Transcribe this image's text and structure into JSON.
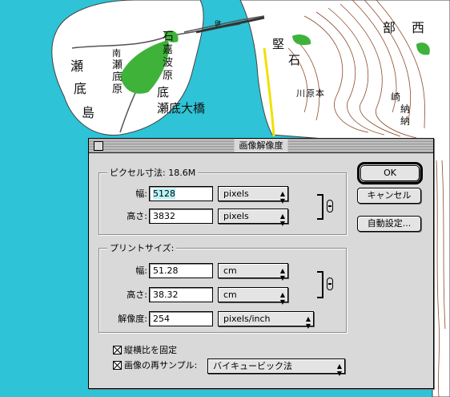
{
  "map": {
    "labels": [
      "瀬",
      "底",
      "島",
      "南",
      "瀬",
      "底",
      "原",
      "石",
      "嘉",
      "波",
      "原",
      "瀬",
      "底",
      "瀬底大橋",
      "健",
      "堅",
      "石",
      "川",
      "原",
      "本",
      "部",
      "西",
      "崎",
      "納"
    ],
    "colors": {
      "sea": "#2ec3d6",
      "land": "#ffffff",
      "vegetation": "#3fb23a",
      "contour": "#8b4a2a",
      "road": "#555555",
      "highlight_road": "#f2e000"
    }
  },
  "dialog": {
    "title": "画像解像度",
    "pixel_dimensions": {
      "label": "ピクセル寸法:  18.6M",
      "width_label": "幅:",
      "width_value": "5128",
      "width_unit": "pixels",
      "height_label": "高さ:",
      "height_value": "3832",
      "height_unit": "pixels"
    },
    "print_size": {
      "label": "プリントサイズ:",
      "width_label": "幅:",
      "width_value": "51.28",
      "width_unit": "cm",
      "height_label": "高さ:",
      "height_value": "38.32",
      "height_unit": "cm",
      "resolution_label": "解像度:",
      "resolution_value": "254",
      "resolution_unit": "pixels/inch"
    },
    "constrain_proportions": {
      "label": "縦横比を固定",
      "checked": true
    },
    "resample": {
      "label": "画像の再サンプル:",
      "checked": true,
      "method": "バイキュービック法"
    },
    "buttons": {
      "ok": "OK",
      "cancel": "キャンセル",
      "auto": "自動設定..."
    },
    "icons": {
      "popup_arrow": "up-down-arrow-icon",
      "link": "chain-link-icon",
      "close": "close-box-icon"
    }
  }
}
